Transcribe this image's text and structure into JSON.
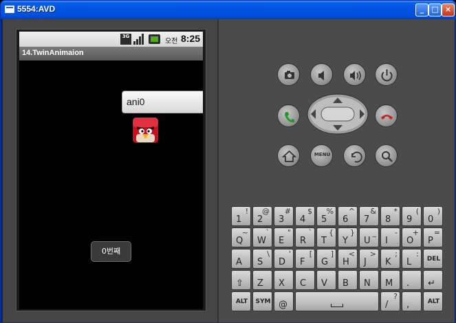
{
  "window": {
    "title": "5554:AVD",
    "min_label": "_",
    "max_label": "□",
    "close_label": "×"
  },
  "statusbar": {
    "network": "3G",
    "ampm": "오전",
    "time": "8:25"
  },
  "app": {
    "title": "14.TwinAnimaion",
    "button_label": "ani0",
    "toast": "0번째"
  },
  "controls": {
    "menu_label": "MENU"
  },
  "keyboard": {
    "row1": [
      {
        "m": "1",
        "a": "!"
      },
      {
        "m": "2",
        "a": "@"
      },
      {
        "m": "3",
        "a": "#"
      },
      {
        "m": "4",
        "a": "$"
      },
      {
        "m": "5",
        "a": "%"
      },
      {
        "m": "6",
        "a": "^"
      },
      {
        "m": "7",
        "a": "&"
      },
      {
        "m": "8",
        "a": "*"
      },
      {
        "m": "9",
        "a": "("
      },
      {
        "m": "0",
        "a": ")"
      }
    ],
    "row2": [
      {
        "m": "Q",
        "a": "~"
      },
      {
        "m": "W",
        "a": "`"
      },
      {
        "m": "E",
        "a": "\""
      },
      {
        "m": "R",
        "a": "`"
      },
      {
        "m": "T",
        "a": "{"
      },
      {
        "m": "Y",
        "a": "}"
      },
      {
        "m": "U",
        "a": "_"
      },
      {
        "m": "I",
        "a": "-"
      },
      {
        "m": "O",
        "a": "+"
      },
      {
        "m": "P",
        "a": "="
      }
    ],
    "row3": [
      {
        "m": "A",
        "a": ""
      },
      {
        "m": "S",
        "a": "\\"
      },
      {
        "m": "D",
        "a": "'"
      },
      {
        "m": "F",
        "a": "["
      },
      {
        "m": "G",
        "a": "]"
      },
      {
        "m": "H",
        "a": "<"
      },
      {
        "m": "J",
        "a": ">"
      },
      {
        "m": "K",
        "a": ";"
      },
      {
        "m": "L",
        "a": ":"
      },
      {
        "m": "DEL",
        "a": ""
      }
    ],
    "row4": [
      {
        "m": "⇧",
        "a": ""
      },
      {
        "m": "Z",
        "a": ""
      },
      {
        "m": "X",
        "a": ""
      },
      {
        "m": "C",
        "a": ""
      },
      {
        "m": "V",
        "a": ""
      },
      {
        "m": "B",
        "a": ""
      },
      {
        "m": "N",
        "a": ""
      },
      {
        "m": "M",
        "a": ""
      },
      {
        "m": ".",
        "a": ""
      },
      {
        "m": "↵",
        "a": ""
      }
    ],
    "row5": {
      "alt_left": "ALT",
      "sym": "SYM",
      "at": "@",
      "slash": "/",
      "slash_alt": "?",
      "comma": ",",
      "alt_right": "ALT"
    }
  },
  "colors": {
    "accent": "#0054e3",
    "screen_bg": "#000000",
    "panel_bg": "#4b4b4b"
  }
}
